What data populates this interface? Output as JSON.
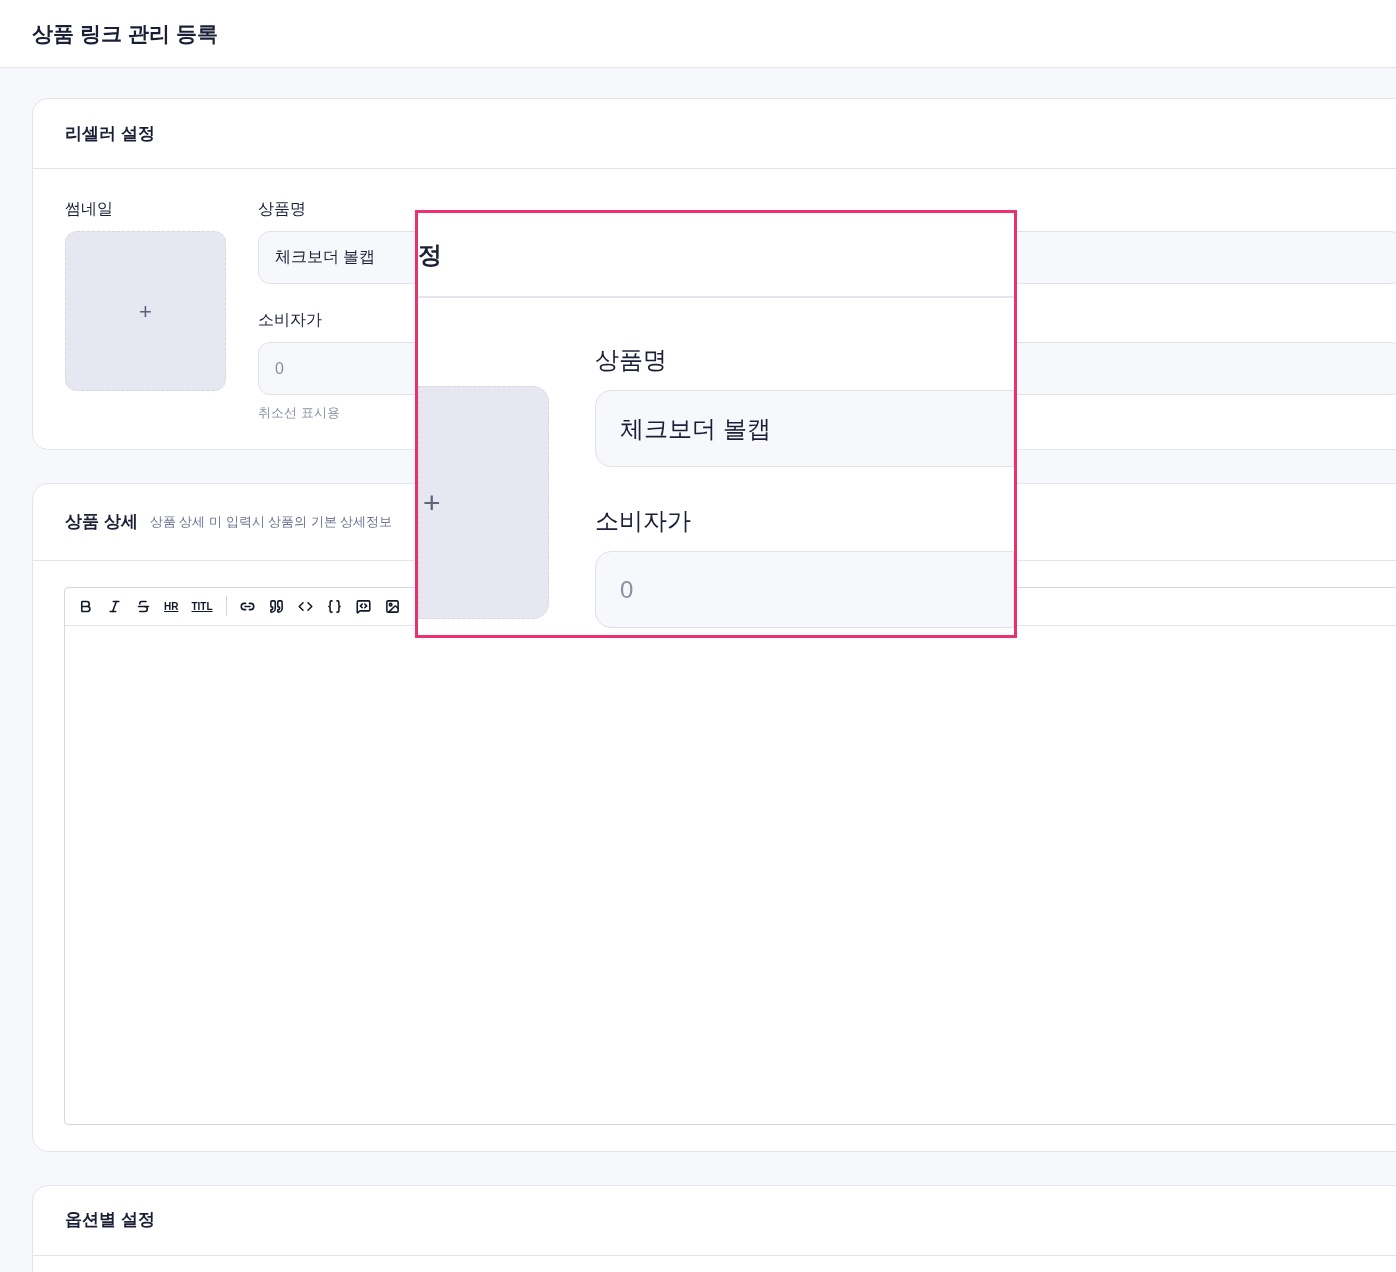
{
  "page": {
    "title": "상품 링크 관리 등록"
  },
  "reseller": {
    "title": "리셀러 설정",
    "thumbnail_label": "썸네일",
    "thumbnail_add": "+",
    "name_label": "상품명",
    "name_value": "체크보더 볼캡",
    "price_label": "소비자가",
    "price_placeholder": "0",
    "price_hint": "취소선 표시용"
  },
  "detail": {
    "title": "상품 상세",
    "hint": "상품 상세 미 입력시 상품의 기본 상세정보",
    "toolbar": [
      {
        "kind": "bold"
      },
      {
        "kind": "italic"
      },
      {
        "kind": "strike"
      },
      {
        "kind": "text",
        "label": "HR"
      },
      {
        "kind": "text",
        "label": "TITL"
      },
      {
        "kind": "separator"
      },
      {
        "kind": "link"
      },
      {
        "kind": "quote"
      },
      {
        "kind": "code"
      },
      {
        "kind": "braces"
      },
      {
        "kind": "embed"
      },
      {
        "kind": "image"
      }
    ]
  },
  "options": {
    "title": "옵션별 설정"
  },
  "zoom_inset": {
    "title_fragment": "정",
    "thumbnail_add": "+",
    "name_label": "상품명",
    "name_value": "체크보더 볼캡",
    "price_label": "소비자가",
    "price_placeholder": "0"
  }
}
